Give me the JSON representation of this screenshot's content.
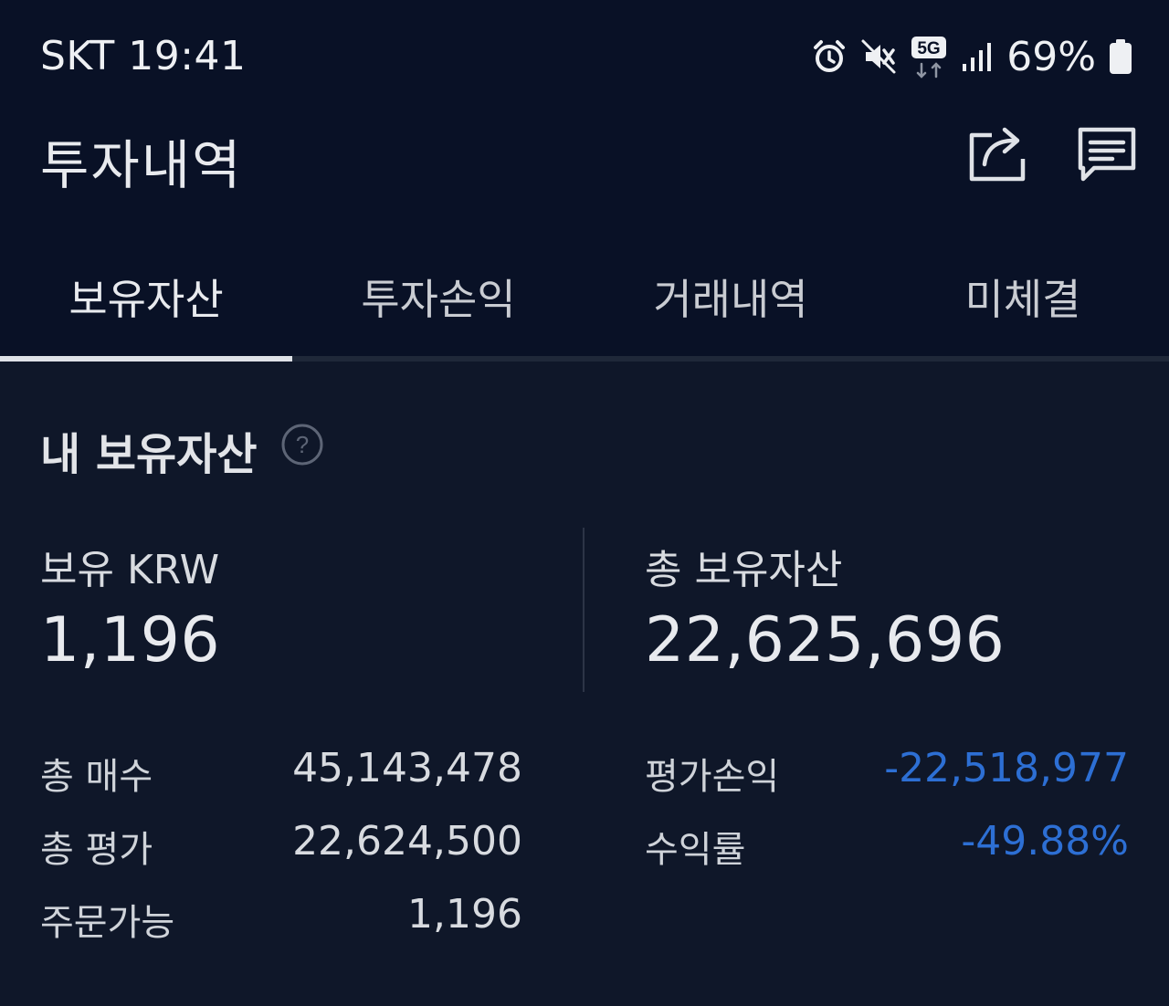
{
  "status_bar": {
    "carrier_time": "SKT 19:41",
    "network_badge": "5G",
    "battery": "69%",
    "icons": [
      "alarm-icon",
      "mute-vibrate-icon",
      "5g-data-icon",
      "signal-icon",
      "battery-icon"
    ]
  },
  "header": {
    "title": "투자내역",
    "actions": [
      "share-icon",
      "message-icon"
    ]
  },
  "tabs": [
    {
      "label": "보유자산",
      "active": true
    },
    {
      "label": "투자손익",
      "active": false
    },
    {
      "label": "거래내역",
      "active": false
    },
    {
      "label": "미체결",
      "active": false
    }
  ],
  "section": {
    "title": "내 보유자산",
    "help_icon": "question-icon"
  },
  "summary": {
    "krw_label": "보유 KRW",
    "krw_value": "1,196",
    "total_label": "총 보유자산",
    "total_value": "22,625,696"
  },
  "details_left": [
    {
      "label": "총 매수",
      "value": "45,143,478"
    },
    {
      "label": "총 평가",
      "value": "22,624,500"
    },
    {
      "label": "주문가능",
      "value": "1,196"
    }
  ],
  "details_right": [
    {
      "label": "평가손익",
      "value": "-22,518,977"
    },
    {
      "label": "수익률",
      "value": "-49.88%"
    }
  ],
  "colors": {
    "background": "#0f1729",
    "header_background": "#091126",
    "negative": "#2d6fd4",
    "text": "#e8eaee"
  }
}
